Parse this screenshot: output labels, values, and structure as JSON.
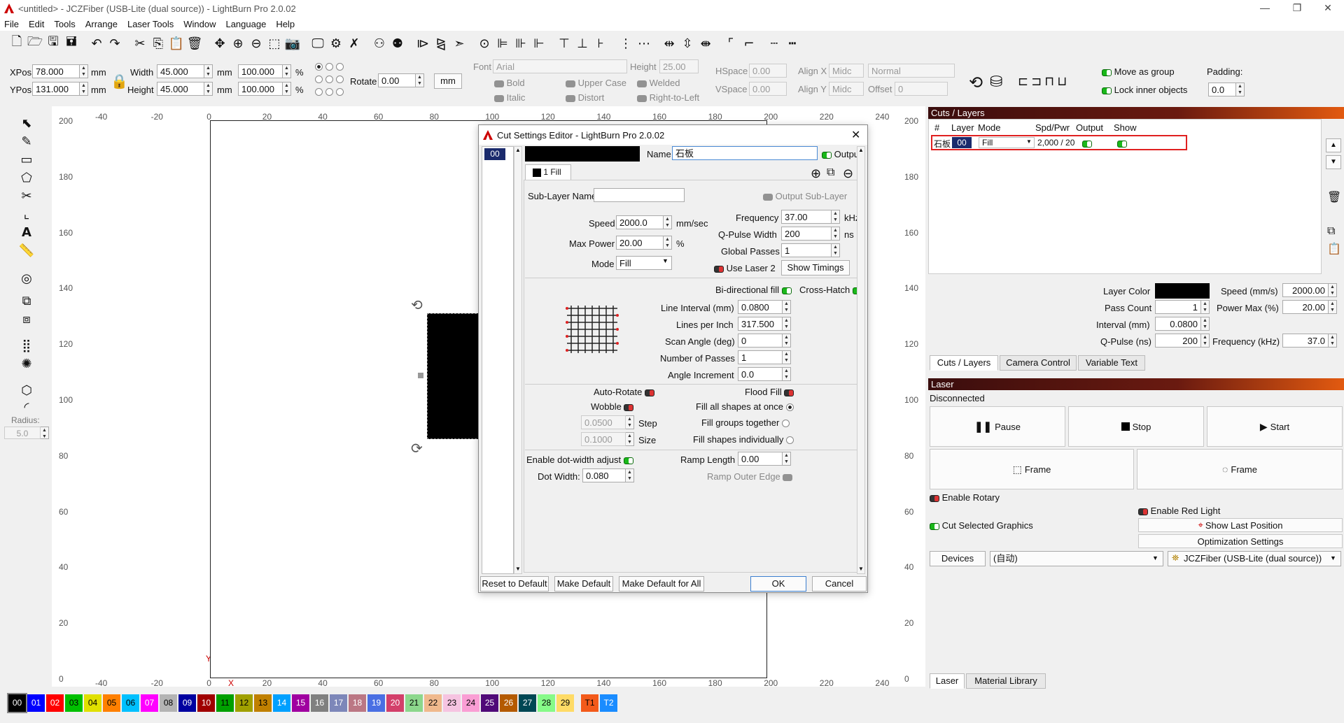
{
  "window": {
    "title": "<untitled> - JCZFiber (USB-Lite (dual source)) - LightBurn Pro 2.0.02"
  },
  "menu": [
    "File",
    "Edit",
    "Tools",
    "Arrange",
    "Laser Tools",
    "Window",
    "Language",
    "Help"
  ],
  "props": {
    "xpos_label": "XPos",
    "xpos": "78.000",
    "ypos_label": "YPos",
    "ypos": "131.000",
    "unit": "mm",
    "width_label": "Width",
    "width": "45.000",
    "height_label": "Height",
    "height": "45.000",
    "scale_w": "100.000",
    "scale_h": "100.000",
    "pct": "%",
    "rotate_label": "Rotate",
    "rotate": "0.00",
    "unit_btn": "mm",
    "font_label": "Font",
    "font_value": "Arial",
    "fheight_label": "Height",
    "fheight": "25.00",
    "hspace_label": "HSpace",
    "hspace": "0.00",
    "vspace_label": "VSpace",
    "vspace": "0.00",
    "alignx_label": "Align X",
    "alignx": "Midc",
    "aligny_label": "Align Y",
    "aligny": "Midc",
    "style": "Normal",
    "offset_label": "Offset",
    "offset": "0",
    "bold": "Bold",
    "italic": "Italic",
    "upper": "Upper Case",
    "distort": "Distort",
    "welded": "Welded",
    "rtl": "Right-to-Left",
    "move_group": "Move as group",
    "lock_inner": "Lock inner objects",
    "padding_label": "Padding:",
    "padding": "0.0"
  },
  "left": {
    "radius_label": "Radius:",
    "radius": "5.0"
  },
  "rulers": {
    "top": [
      "-40",
      "-20",
      "0",
      "20",
      "40",
      "60",
      "80",
      "100",
      "120",
      "140",
      "160",
      "180",
      "200",
      "220",
      "240"
    ],
    "side": [
      "200",
      "180",
      "160",
      "140",
      "120",
      "100",
      "80",
      "60",
      "40",
      "20",
      "0"
    ],
    "bottom": [
      "-40",
      "-20",
      "0",
      "20",
      "40",
      "60",
      "80",
      "100",
      "120",
      "140",
      "160",
      "180",
      "200",
      "220",
      "240"
    ],
    "x_axis": "X",
    "y_axis": "Y"
  },
  "dialog": {
    "title": "Cut Settings Editor - LightBurn Pro 2.0.02",
    "layer_num": "00",
    "name_label": "Name",
    "name_value": "石板",
    "output_label": "Output",
    "sub_tab": "1 Fill",
    "sublayer_label": "Sub-Layer Name",
    "output_sub": "Output Sub-Layer",
    "speed_label": "Speed",
    "speed": "2000.0",
    "speed_unit": "mm/sec",
    "maxpower_label": "Max Power",
    "maxpower": "20.00",
    "maxpower_unit": "%",
    "mode_label": "Mode",
    "mode": "Fill",
    "freq_label": "Frequency",
    "freq": "37.00",
    "freq_unit": "kHz",
    "qpulse_label": "Q-Pulse Width",
    "qpulse": "200",
    "qpulse_unit": "ns",
    "passes_label": "Global Passes",
    "passes": "1",
    "uselaser2": "Use Laser 2",
    "show_timings": "Show Timings",
    "bidir": "Bi-directional fill",
    "crosshatch": "Cross-Hatch",
    "line_interval_label": "Line Interval (mm)",
    "line_interval": "0.0800",
    "lpi_label": "Lines per Inch",
    "lpi": "317.500",
    "scan_angle_label": "Scan Angle (deg)",
    "scan_angle": "0",
    "num_passes_label": "Number of Passes",
    "num_passes": "1",
    "angle_inc_label": "Angle Increment",
    "angle_inc": "0.0",
    "autorotate": "Auto-Rotate",
    "floodfill": "Flood Fill",
    "wobble": "Wobble",
    "fill_all": "Fill all shapes at once",
    "fill_groups": "Fill groups together",
    "fill_indiv": "Fill shapes individually",
    "step": "0.0500",
    "step_label": "Step",
    "size": "0.1000",
    "size_label": "Size",
    "dot_adjust": "Enable dot-width adjust",
    "ramp_label": "Ramp Length",
    "ramp": "0.00",
    "dotwidth_label": "Dot Width:",
    "dotwidth": "0.080",
    "ramp_outer": "Ramp Outer Edge",
    "reset": "Reset to Default",
    "make_default": "Make Default",
    "make_default_all": "Make Default for All",
    "ok": "OK",
    "cancel": "Cancel"
  },
  "cuts": {
    "title": "Cuts / Layers",
    "headers": [
      "#",
      "Layer",
      "Mode",
      "Spd/Pwr",
      "Output",
      "Show"
    ],
    "row": {
      "name": "石板",
      "layer": "00",
      "mode": "Fill",
      "spdpwr": "2,000 / 20"
    },
    "layer_color_label": "Layer Color",
    "pass_count_label": "Pass Count",
    "pass_count": "1",
    "interval_label": "Interval (mm)",
    "interval": "0.0800",
    "qpulse_label": "Q-Pulse (ns)",
    "qpulse": "200",
    "speed_label": "Speed (mm/s)",
    "speed": "2000.00",
    "power_label": "Power Max (%)",
    "power": "20.00",
    "freq_label": "Frequency (kHz)",
    "freq": "37.0",
    "tabs": [
      "Cuts / Layers",
      "Camera Control",
      "Variable Text"
    ]
  },
  "laser": {
    "title": "Laser",
    "status": "Disconnected",
    "pause": "Pause",
    "stop": "Stop",
    "start": "Start",
    "frame1": "Frame",
    "frame2": "Frame",
    "rotary": "Enable Rotary",
    "redlight": "Enable Red Light",
    "cut_selected": "Cut Selected Graphics",
    "show_last": "Show Last Position",
    "optimization": "Optimization Settings",
    "devices": "Devices",
    "port": "(自动)",
    "device": "JCZFiber (USB-Lite (dual source))",
    "tabs": [
      "Laser",
      "Material Library"
    ]
  },
  "palette": [
    {
      "n": "00",
      "c": "#000000",
      "t": "#ffffff"
    },
    {
      "n": "01",
      "c": "#0000ff",
      "t": "#ffffff"
    },
    {
      "n": "02",
      "c": "#ff0000",
      "t": "#ffffff"
    },
    {
      "n": "03",
      "c": "#00c000",
      "t": "#000000"
    },
    {
      "n": "04",
      "c": "#e0e000",
      "t": "#000000"
    },
    {
      "n": "05",
      "c": "#ff8000",
      "t": "#000000"
    },
    {
      "n": "06",
      "c": "#00c0ff",
      "t": "#000000"
    },
    {
      "n": "07",
      "c": "#ff00ff",
      "t": "#ffffff"
    },
    {
      "n": "08",
      "c": "#b4b4b4",
      "t": "#000000"
    },
    {
      "n": "09",
      "c": "#0000a0",
      "t": "#ffffff"
    },
    {
      "n": "10",
      "c": "#a00000",
      "t": "#ffffff"
    },
    {
      "n": "11",
      "c": "#00a000",
      "t": "#000000"
    },
    {
      "n": "12",
      "c": "#a0a000",
      "t": "#000000"
    },
    {
      "n": "13",
      "c": "#c08000",
      "t": "#000000"
    },
    {
      "n": "14",
      "c": "#00a0ff",
      "t": "#ffffff"
    },
    {
      "n": "15",
      "c": "#a000a0",
      "t": "#ffffff"
    },
    {
      "n": "16",
      "c": "#808080",
      "t": "#ffffff"
    },
    {
      "n": "17",
      "c": "#7d87b9",
      "t": "#ffffff"
    },
    {
      "n": "18",
      "c": "#bb7784",
      "t": "#ffffff"
    },
    {
      "n": "19",
      "c": "#4a6fe3",
      "t": "#ffffff"
    },
    {
      "n": "20",
      "c": "#d33f6a",
      "t": "#ffffff"
    },
    {
      "n": "21",
      "c": "#8cd78c",
      "t": "#000000"
    },
    {
      "n": "22",
      "c": "#f0b98d",
      "t": "#000000"
    },
    {
      "n": "23",
      "c": "#f6c4e1",
      "t": "#000000"
    },
    {
      "n": "24",
      "c": "#fa9ed4",
      "t": "#000000"
    },
    {
      "n": "25",
      "c": "#500a78",
      "t": "#ffffff"
    },
    {
      "n": "26",
      "c": "#b45a00",
      "t": "#ffffff"
    },
    {
      "n": "27",
      "c": "#004754",
      "t": "#ffffff"
    },
    {
      "n": "28",
      "c": "#86fa88",
      "t": "#000000"
    },
    {
      "n": "29",
      "c": "#ffdb66",
      "t": "#000000"
    },
    {
      "n": "T1",
      "c": "#f35a1a",
      "t": "#000000"
    },
    {
      "n": "T2",
      "c": "#1a8cff",
      "t": "#ffffff"
    }
  ]
}
